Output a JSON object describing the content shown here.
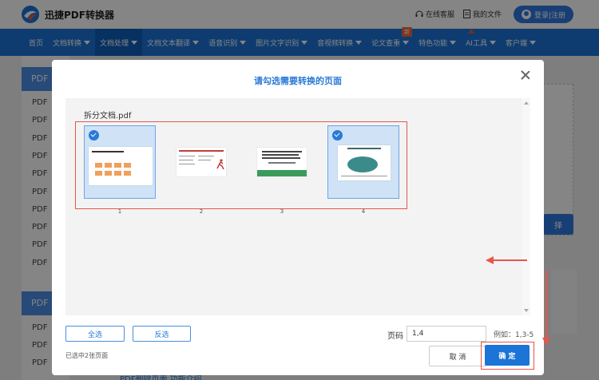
{
  "header": {
    "brand": "迅捷PDF转换器",
    "online_service": "在线客服",
    "my_files": "我的文件",
    "login": "登录|注册"
  },
  "nav": {
    "items": [
      {
        "label": "首页",
        "caret": false
      },
      {
        "label": "文档转换",
        "caret": true
      },
      {
        "label": "文档处理",
        "caret": true,
        "active": true
      },
      {
        "label": "文档文本翻译",
        "caret": true
      },
      {
        "label": "语音识别",
        "caret": true
      },
      {
        "label": "图片文字识别",
        "caret": true
      },
      {
        "label": "音视频转换",
        "caret": true
      },
      {
        "label": "论文查重",
        "caret": true,
        "badge": "新"
      },
      {
        "label": "特色功能",
        "caret": true
      },
      {
        "label": "AI工具",
        "caret": true
      },
      {
        "label": "客户端",
        "caret": true
      }
    ]
  },
  "background": {
    "sidebar_head_1": "PDF",
    "sidebar_items": [
      "PDF",
      "PDF",
      "PDF",
      "PDF",
      "PDF",
      "PDF",
      "PDF",
      "PDF",
      "PDF",
      "PDF"
    ],
    "sidebar_head_2": "PDF",
    "sidebar_items_2": [
      "PDF",
      "PDF",
      "PDF"
    ],
    "right_button": "择",
    "bottom_text": "PDF删除页面 功能介绍"
  },
  "modal": {
    "title": "请勾选需要转换的页面",
    "filename": "拆分文档.pdf",
    "pages": [
      {
        "number": "1",
        "selected": true
      },
      {
        "number": "2",
        "selected": false
      },
      {
        "number": "3",
        "selected": false
      },
      {
        "number": "4",
        "selected": true
      }
    ],
    "select_all": "全选",
    "invert_selection": "反选",
    "page_code_label": "页码",
    "page_code_value": "1,4",
    "example": "例如：1,3-5",
    "selected_info": "已选中2张页面",
    "cancel": "取 消",
    "confirm": "确 定"
  },
  "colors": {
    "nav_blue": "#1b74d6",
    "accent_red": "#e5564b",
    "title_blue": "#2a7ad6"
  }
}
